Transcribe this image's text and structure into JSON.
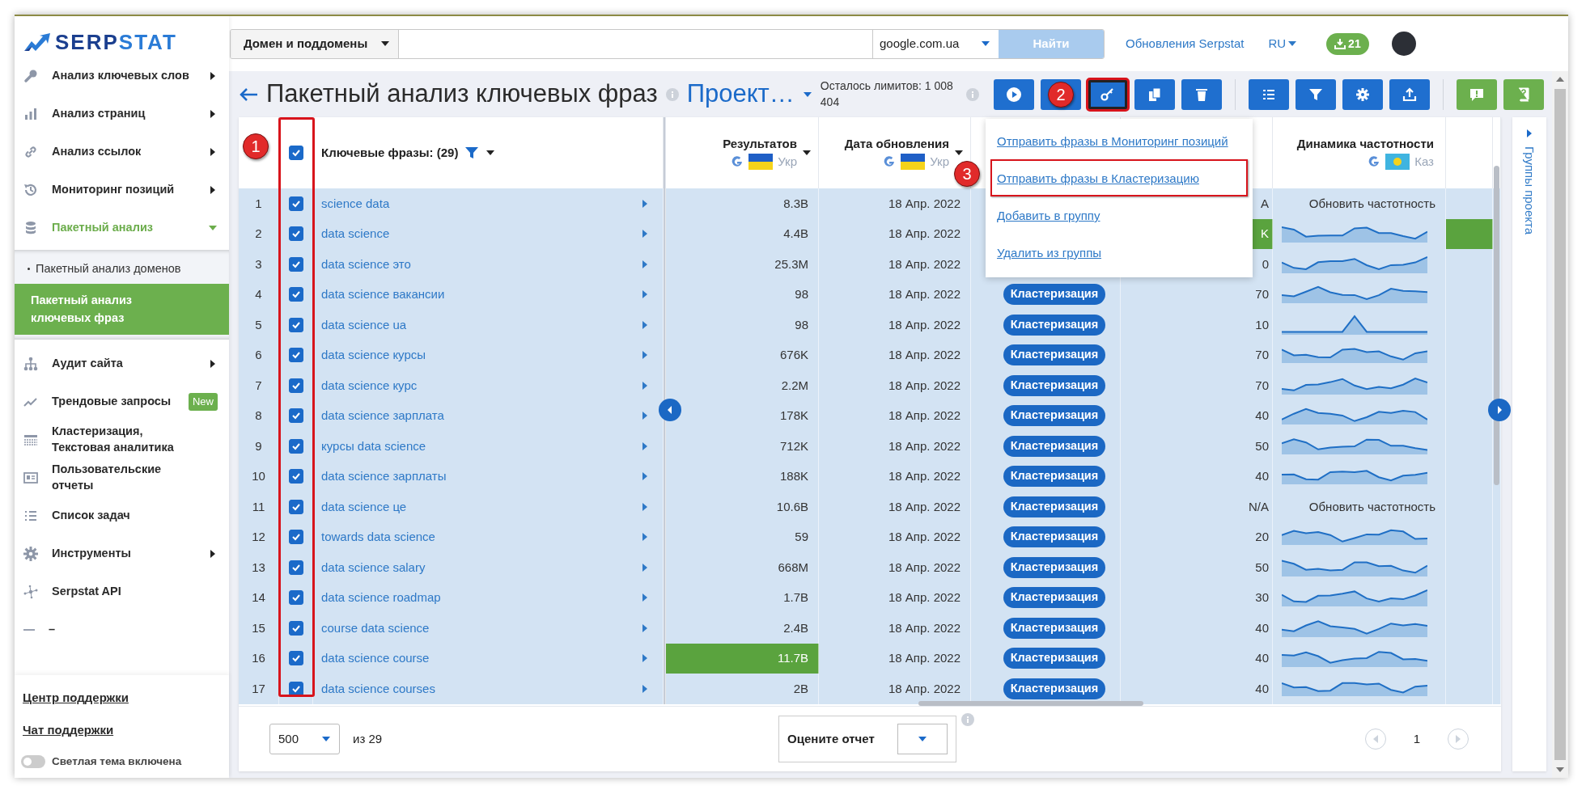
{
  "logo": {
    "part_1": "SERP",
    "part_2": "STAT"
  },
  "search": {
    "scope": "Домен и поддомены",
    "engine": "google.com.ua",
    "button": "Найти"
  },
  "header": {
    "updates_link": "Обновления Serpstat",
    "language": "RU",
    "downloads": "21"
  },
  "sidebar": {
    "items": [
      {
        "label": "Анализ ключевых слов",
        "has_submenu": true,
        "expanded": false
      },
      {
        "label": "Анализ страниц",
        "has_submenu": true,
        "expanded": false
      },
      {
        "label": "Анализ ссылок",
        "has_submenu": true,
        "expanded": false
      },
      {
        "label": "Мониторинг позиций",
        "has_submenu": true,
        "expanded": false
      },
      {
        "label": "Пакетный анализ",
        "has_submenu": true,
        "expanded": true,
        "children": [
          {
            "label": "Пакетный анализ доменов",
            "selected": false
          },
          {
            "label": "Пакетный анализ ключевых фраз",
            "selected": true
          }
        ]
      },
      {
        "label": "Аудит сайта",
        "has_submenu": true,
        "expanded": false
      },
      {
        "label": "Трендовые запросы",
        "has_submenu": false,
        "expanded": false,
        "badge": "New"
      },
      {
        "label": "Кластеризация, Текстовая аналитика",
        "has_submenu": false,
        "expanded": false
      },
      {
        "label": "Пользовательские отчеты",
        "has_submenu": false,
        "expanded": false
      },
      {
        "label": "Список задач",
        "has_submenu": false,
        "expanded": false
      },
      {
        "label": "Инструменты",
        "has_submenu": true,
        "expanded": false
      },
      {
        "label": "Serpstat API",
        "has_submenu": false,
        "expanded": false
      },
      {
        "label": "–",
        "has_submenu": false,
        "expanded": false
      }
    ],
    "footer_links": [
      "Центр поддержки",
      "Чат поддержки"
    ],
    "theme_toggle": {
      "label": "Светлая тема включена",
      "on": false
    }
  },
  "page": {
    "title": "Пакетный анализ ключевых фраз",
    "project": "Проект…",
    "limits": "Осталось лимитов: 1 008 404"
  },
  "toolbar": {
    "groups": [
      [
        {
          "color": "#1f6fcf",
          "highlighted": false
        },
        {
          "color": "#1f6fcf",
          "highlighted": false
        },
        {
          "color": "#1f6fcf",
          "highlighted": true
        },
        {
          "color": "#1f6fcf",
          "highlighted": false
        },
        {
          "color": "#1f6fcf",
          "highlighted": false
        }
      ],
      [
        {
          "color": "#1f6fcf",
          "highlighted": false
        },
        {
          "color": "#1f6fcf",
          "highlighted": false
        },
        {
          "color": "#1f6fcf",
          "highlighted": false
        },
        {
          "color": "#1f6fcf",
          "highlighted": false
        }
      ],
      [
        {
          "color": "#6cb04e",
          "highlighted": false
        },
        {
          "color": "#6cb04e",
          "highlighted": false
        }
      ]
    ]
  },
  "menu": {
    "items": [
      {
        "label": "Отправить фразы в Мониторинг позиций",
        "highlighted": false
      },
      {
        "label": "Отправить фразы в Кластеризацию",
        "highlighted": true
      },
      {
        "label": "Добавить в группу",
        "highlighted": false
      },
      {
        "label": "Удалить из группы",
        "highlighted": false
      }
    ]
  },
  "table": {
    "select_all_checked": true,
    "checkbox_column_highlighted": true,
    "keyword_header": "Ключевые фразы: (29)",
    "columns": [
      {
        "title": "Результатов",
        "region": "Укр",
        "has_menu": true
      },
      {
        "title": "Дата обновления",
        "region": "Укр",
        "has_menu": true
      },
      {
        "title": "Динамика частотности",
        "region": "Каз",
        "has_menu": false
      }
    ],
    "rows": [
      {
        "number": "1",
        "checked": true,
        "keyword": "science data",
        "results": "8.3B",
        "results_highlighted": false,
        "date": "18 Апр. 2022",
        "column_7": "A",
        "column_7_highlighted": false,
        "dynamics": {
          "kind": "text",
          "text": "Обновить частотность"
        },
        "column_9_highlighted": false
      },
      {
        "number": "2",
        "checked": true,
        "keyword": "data science",
        "results": "4.4B",
        "results_highlighted": false,
        "date": "18 Апр. 2022",
        "column_7": "K",
        "column_7_highlighted": true,
        "dynamics": {
          "kind": "sparkline"
        },
        "column_9_highlighted": true
      },
      {
        "number": "3",
        "checked": true,
        "keyword": "data science это",
        "results": "25.3M",
        "results_highlighted": false,
        "date": "18 Апр. 2022",
        "column_7": "0",
        "column_7_highlighted": false,
        "dynamics": {
          "kind": "sparkline"
        },
        "column_9_highlighted": false
      },
      {
        "number": "4",
        "checked": true,
        "keyword": "data science вакансии",
        "results": "98",
        "results_highlighted": false,
        "date": "18 Апр. 2022",
        "cluster": "Кластеризация",
        "column_7": "70",
        "column_7_highlighted": false,
        "dynamics": {
          "kind": "sparkline"
        },
        "column_9_highlighted": false
      },
      {
        "number": "5",
        "checked": true,
        "keyword": "data science ua",
        "results": "98",
        "results_highlighted": false,
        "date": "18 Апр. 2022",
        "cluster": "Кластеризация",
        "column_7": "10",
        "column_7_highlighted": false,
        "dynamics": {
          "kind": "sparkline"
        },
        "column_9_highlighted": false
      },
      {
        "number": "6",
        "checked": true,
        "keyword": "data science курсы",
        "results": "676K",
        "results_highlighted": false,
        "date": "18 Апр. 2022",
        "cluster": "Кластеризация",
        "column_7": "70",
        "column_7_highlighted": false,
        "dynamics": {
          "kind": "sparkline"
        },
        "column_9_highlighted": false
      },
      {
        "number": "7",
        "checked": true,
        "keyword": "data science курс",
        "results": "2.2M",
        "results_highlighted": false,
        "date": "18 Апр. 2022",
        "cluster": "Кластеризация",
        "column_7": "70",
        "column_7_highlighted": false,
        "dynamics": {
          "kind": "sparkline"
        },
        "column_9_highlighted": false
      },
      {
        "number": "8",
        "checked": true,
        "keyword": "data science зарплата",
        "results": "178K",
        "results_highlighted": false,
        "date": "18 Апр. 2022",
        "cluster": "Кластеризация",
        "column_7": "40",
        "column_7_highlighted": false,
        "dynamics": {
          "kind": "sparkline"
        },
        "column_9_highlighted": false
      },
      {
        "number": "9",
        "checked": true,
        "keyword": "курсы data science",
        "results": "712K",
        "results_highlighted": false,
        "date": "18 Апр. 2022",
        "cluster": "Кластеризация",
        "column_7": "50",
        "column_7_highlighted": false,
        "dynamics": {
          "kind": "sparkline"
        },
        "column_9_highlighted": false
      },
      {
        "number": "10",
        "checked": true,
        "keyword": "data science зарплаты",
        "results": "188K",
        "results_highlighted": false,
        "date": "18 Апр. 2022",
        "cluster": "Кластеризация",
        "column_7": "40",
        "column_7_highlighted": false,
        "dynamics": {
          "kind": "sparkline"
        },
        "column_9_highlighted": false
      },
      {
        "number": "11",
        "checked": true,
        "keyword": "data science це",
        "results": "10.6B",
        "results_highlighted": false,
        "date": "18 Апр. 2022",
        "cluster": "Кластеризация",
        "column_7": "N/A",
        "column_7_highlighted": false,
        "dynamics": {
          "kind": "text",
          "text": "Обновить частотность"
        },
        "column_9_highlighted": false
      },
      {
        "number": "12",
        "checked": true,
        "keyword": "towards data science",
        "results": "59",
        "results_highlighted": false,
        "date": "18 Апр. 2022",
        "cluster": "Кластеризация",
        "column_7": "20",
        "column_7_highlighted": false,
        "dynamics": {
          "kind": "sparkline"
        },
        "column_9_highlighted": false
      },
      {
        "number": "13",
        "checked": true,
        "keyword": "data science salary",
        "results": "668M",
        "results_highlighted": false,
        "date": "18 Апр. 2022",
        "cluster": "Кластеризация",
        "column_7": "50",
        "column_7_highlighted": false,
        "dynamics": {
          "kind": "sparkline"
        },
        "column_9_highlighted": false
      },
      {
        "number": "14",
        "checked": true,
        "keyword": "data science roadmap",
        "results": "1.7B",
        "results_highlighted": false,
        "date": "18 Апр. 2022",
        "cluster": "Кластеризация",
        "column_7": "30",
        "column_7_highlighted": false,
        "dynamics": {
          "kind": "sparkline"
        },
        "column_9_highlighted": false
      },
      {
        "number": "15",
        "checked": true,
        "keyword": "course data science",
        "results": "2.4B",
        "results_highlighted": false,
        "date": "18 Апр. 2022",
        "cluster": "Кластеризация",
        "column_7": "40",
        "column_7_highlighted": false,
        "dynamics": {
          "kind": "sparkline"
        },
        "column_9_highlighted": false
      },
      {
        "number": "16",
        "checked": true,
        "keyword": "data science course",
        "results": "11.7B",
        "results_highlighted": true,
        "date": "18 Апр. 2022",
        "cluster": "Кластеризация",
        "column_7": "40",
        "column_7_highlighted": false,
        "dynamics": {
          "kind": "sparkline"
        },
        "column_9_highlighted": false
      },
      {
        "number": "17",
        "checked": true,
        "keyword": "data science courses",
        "results": "2B",
        "results_highlighted": false,
        "date": "18 Апр. 2022",
        "cluster": "Кластеризация",
        "column_7": "40",
        "column_7_highlighted": false,
        "dynamics": {
          "kind": "sparkline"
        },
        "column_9_highlighted": false
      }
    ]
  },
  "footer": {
    "per_page": "500",
    "total": "из 29",
    "rate_label": "Оцените отчет",
    "page": "1"
  },
  "side_panel": {
    "title": "Группы проекта"
  },
  "annotations": [
    {
      "label": "1",
      "kind": "checkbox_column"
    },
    {
      "label": "2",
      "kind": "toolbar"
    },
    {
      "label": "3",
      "kind": "menu"
    }
  ]
}
